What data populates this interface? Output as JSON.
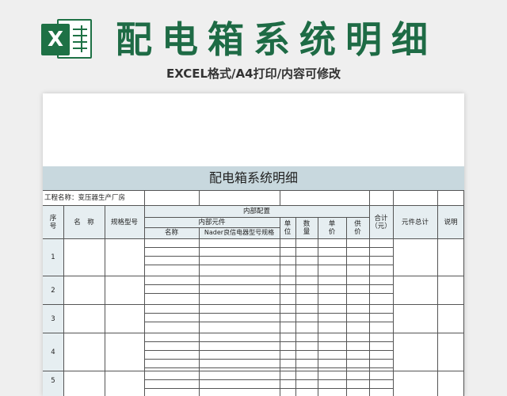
{
  "banner": {
    "logo_letter": "X",
    "title": "配电箱系统明细",
    "subtitle": "EXCEL格式/A4打印/内容可修改"
  },
  "sheet": {
    "title": "配电箱系统明细",
    "project_label": "工程名称：变压器生产厂房",
    "headers": {
      "seq": "序号",
      "name": "名　称",
      "spec": "规格型号",
      "internal_config": "内部配置",
      "internal_parts": "内部元件",
      "part_name": "名称",
      "part_spec": "Nader良信电器型号规格",
      "unit": "单位",
      "qty": "数量",
      "unit_price": "单价",
      "supply_price": "供价",
      "total": "合计（元）",
      "parts_total": "元件总计",
      "notes": "说明"
    },
    "rows": [
      "1",
      "2",
      "3",
      "4",
      "5"
    ]
  },
  "colors": {
    "brand_green": "#1e6b45",
    "title_band": "#c8d8de",
    "background": "#efefef"
  }
}
